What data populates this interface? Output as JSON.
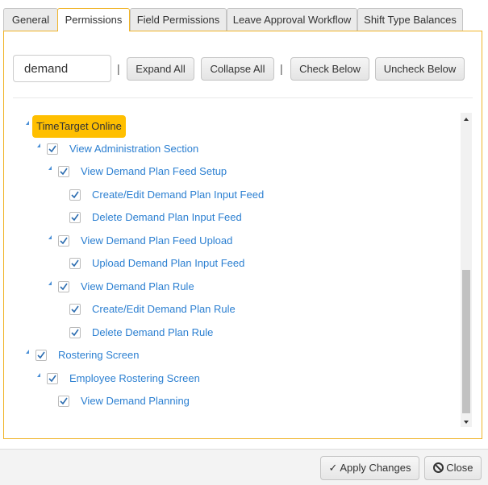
{
  "tabs": [
    {
      "label": "General"
    },
    {
      "label": "Permissions",
      "active": true
    },
    {
      "label": "Field Permissions"
    },
    {
      "label": "Leave Approval Workflow"
    },
    {
      "label": "Shift Type Balances"
    }
  ],
  "toolbar": {
    "search_value": "demand",
    "separator": "|",
    "expand_all": "Expand All",
    "collapse_all": "Collapse All",
    "check_below": "Check Below",
    "uncheck_below": "Uncheck Below"
  },
  "tree": {
    "root": "TimeTarget Online",
    "items": [
      {
        "label": "View Administration Section",
        "checked": true
      },
      {
        "label": "View Demand Plan Feed Setup",
        "checked": true
      },
      {
        "label": "Create/Edit Demand Plan Input Feed",
        "checked": true
      },
      {
        "label": "Delete Demand Plan Input Feed",
        "checked": true
      },
      {
        "label": "View Demand Plan Feed Upload",
        "checked": true
      },
      {
        "label": "Upload Demand Plan Input Feed",
        "checked": true
      },
      {
        "label": "View Demand Plan Rule",
        "checked": true
      },
      {
        "label": "Create/Edit Demand Plan Rule",
        "checked": true
      },
      {
        "label": "Delete Demand Plan Rule",
        "checked": true
      },
      {
        "label": "Rostering Screen",
        "checked": true
      },
      {
        "label": "Employee Rostering Screen",
        "checked": true
      },
      {
        "label": "View Demand Planning",
        "checked": true
      }
    ]
  },
  "footer": {
    "apply": "Apply Changes",
    "close": "Close"
  },
  "colors": {
    "accent": "#f0b429",
    "highlight": "#ffbf00",
    "link": "#2b7fd1"
  }
}
